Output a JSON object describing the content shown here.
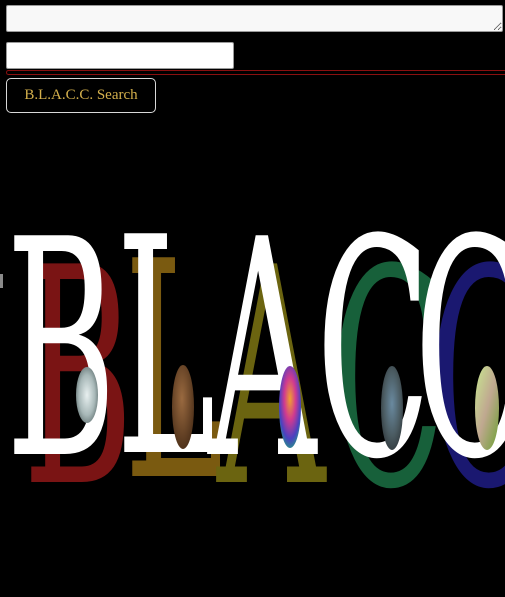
{
  "form": {
    "textarea_value": "",
    "input_value": "",
    "search_button_label": "B.L.A.C.C. Search"
  },
  "banner": {
    "logo_text": "B.L.A.C.C.",
    "letters": [
      {
        "char": "B",
        "shadow_color": "#7a1414",
        "face_color": "#ffffff"
      },
      {
        "char": "L",
        "shadow_color": "#7a5a10",
        "face_color": "#ffffff"
      },
      {
        "char": "A",
        "shadow_color": "#6b6410",
        "face_color": "#ffffff"
      },
      {
        "char": "C",
        "shadow_color": "#17603a",
        "face_color": "#ffffff"
      },
      {
        "char": "C",
        "shadow_color": "#1a1870",
        "face_color": "#ffffff"
      }
    ],
    "dots": [
      {
        "icon": "marble-pattern-icon",
        "color": "#c8d4d4"
      },
      {
        "icon": "wood-texture-icon",
        "color": "#7a5230"
      },
      {
        "icon": "psychedelic-swirl-icon",
        "color": "#c040a0"
      },
      {
        "icon": "mosaic-stone-icon",
        "color": "#4a6a80"
      },
      {
        "icon": "green-leaf-icon",
        "color": "#8fc04a"
      }
    ]
  },
  "colors": {
    "background": "#000000",
    "button_text": "#d4b04c",
    "rule": "#8a1010"
  }
}
